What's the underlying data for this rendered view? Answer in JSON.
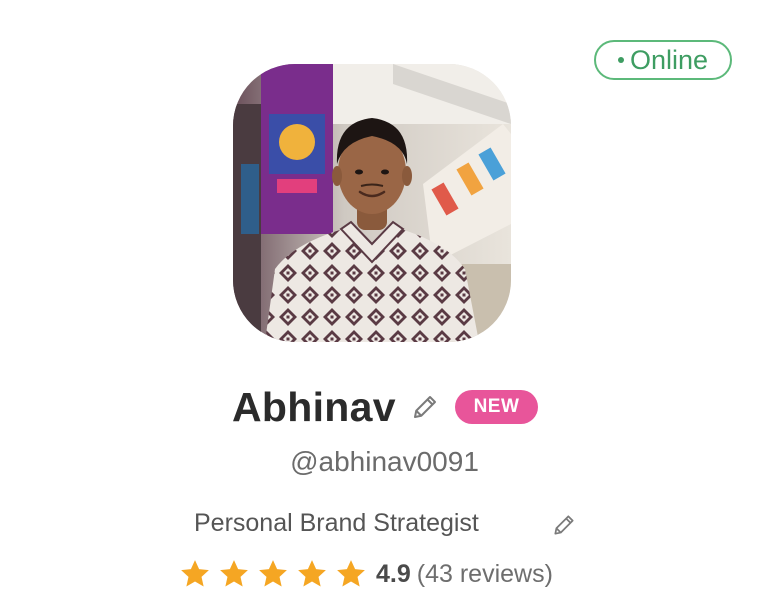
{
  "status": {
    "label": "Online",
    "color": "#3e9d62"
  },
  "profile": {
    "name": "Abhinav",
    "badge": "NEW",
    "username": "@abhinav0091",
    "role": "Personal Brand Strategist",
    "avatar_icon": "profile-photo"
  },
  "rating": {
    "stars": 5,
    "value": "4.9",
    "reviews_text": "(43 reviews)"
  },
  "icons": {
    "edit": "pencil-icon",
    "star": "star-icon",
    "status": "online-dot-icon"
  },
  "colors": {
    "badge": "#e8559a",
    "star": "#f5a623",
    "online": "#5cb97a"
  }
}
